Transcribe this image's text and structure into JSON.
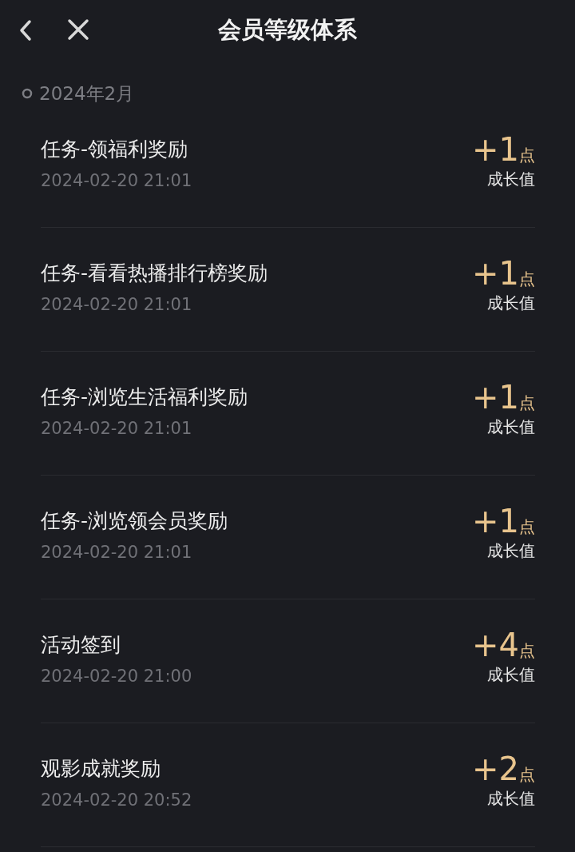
{
  "header": {
    "title": "会员等级体系"
  },
  "section": {
    "label": "2024年2月",
    "entries": [
      {
        "title": "任务-领福利奖励",
        "time": "2024-02-20 21:01",
        "points": "+1",
        "unit": "点",
        "caption": "成长值"
      },
      {
        "title": "任务-看看热播排行榜奖励",
        "time": "2024-02-20 21:01",
        "points": "+1",
        "unit": "点",
        "caption": "成长值"
      },
      {
        "title": "任务-浏览生活福利奖励",
        "time": "2024-02-20 21:01",
        "points": "+1",
        "unit": "点",
        "caption": "成长值"
      },
      {
        "title": "任务-浏览领会员奖励",
        "time": "2024-02-20 21:01",
        "points": "+1",
        "unit": "点",
        "caption": "成长值"
      },
      {
        "title": "活动签到",
        "time": "2024-02-20 21:00",
        "points": "+4",
        "unit": "点",
        "caption": "成长值"
      },
      {
        "title": "观影成就奖励",
        "time": "2024-02-20 20:52",
        "points": "+2",
        "unit": "点",
        "caption": "成长值"
      }
    ]
  }
}
